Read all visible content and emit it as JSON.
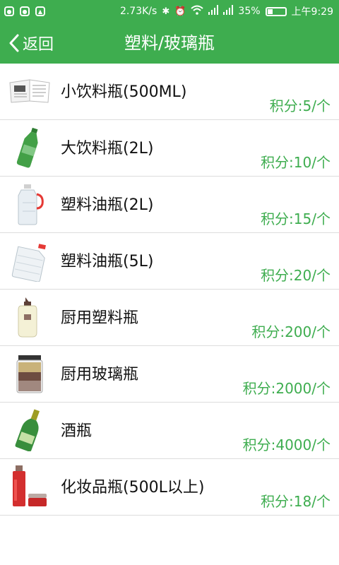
{
  "status_bar": {
    "network_speed": "2.73K/s",
    "battery_percent": "35%",
    "battery_level": 0.35,
    "time": "上午9:29"
  },
  "header": {
    "back_label": "返回",
    "title": "塑料/玻璃瓶",
    "accent_color": "#3ead4f"
  },
  "items": [
    {
      "name": "小饮料瓶(500ML)",
      "points": "积分:5/个",
      "icon": "magazine-thumbnail"
    },
    {
      "name": "大饮料瓶(2L)",
      "points": "积分:10/个",
      "icon": "green-soda-bottle"
    },
    {
      "name": "塑料油瓶(2L)",
      "points": "积分:15/个",
      "icon": "plastic-oil-bottle"
    },
    {
      "name": "塑料油瓶(5L)",
      "points": "积分:20/个",
      "icon": "large-oil-jug"
    },
    {
      "name": "厨用塑料瓶",
      "points": "积分:200/个",
      "icon": "squeeze-bottle"
    },
    {
      "name": "厨用玻璃瓶",
      "points": "积分:2000/个",
      "icon": "glass-jar"
    },
    {
      "name": "酒瓶",
      "points": "积分:4000/个",
      "icon": "wine-bottle"
    },
    {
      "name": "化妆品瓶(500L以上)",
      "points": "积分:18/个",
      "icon": "cosmetic-bottles"
    }
  ]
}
